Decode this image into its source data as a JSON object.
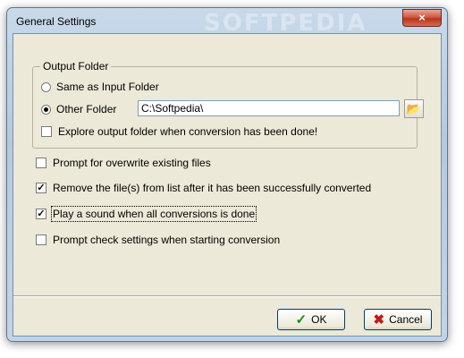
{
  "window": {
    "title": "General Settings",
    "watermark": "SOFTPEDIA",
    "close_glyph": "×"
  },
  "output_folder": {
    "group_label": "Output Folder",
    "same_as_input_label": "Same as Input Folder",
    "other_folder_label": "Other Folder",
    "selected": "other",
    "path_value": "C:\\Softpedia\\",
    "browse_icon": "folder-open-icon",
    "explore_label": "Explore output folder when conversion has been done!",
    "explore_checked": false
  },
  "options": [
    {
      "label": "Prompt for overwrite existing files",
      "checked": false
    },
    {
      "label": "Remove the file(s) from list after it has been successfully converted",
      "checked": true
    },
    {
      "label": "Play a sound when all conversions is done",
      "checked": true
    },
    {
      "label": "Prompt check settings when starting conversion",
      "checked": false
    }
  ],
  "buttons": {
    "ok_label": "OK",
    "cancel_label": "Cancel"
  },
  "check_glyph": "✓"
}
